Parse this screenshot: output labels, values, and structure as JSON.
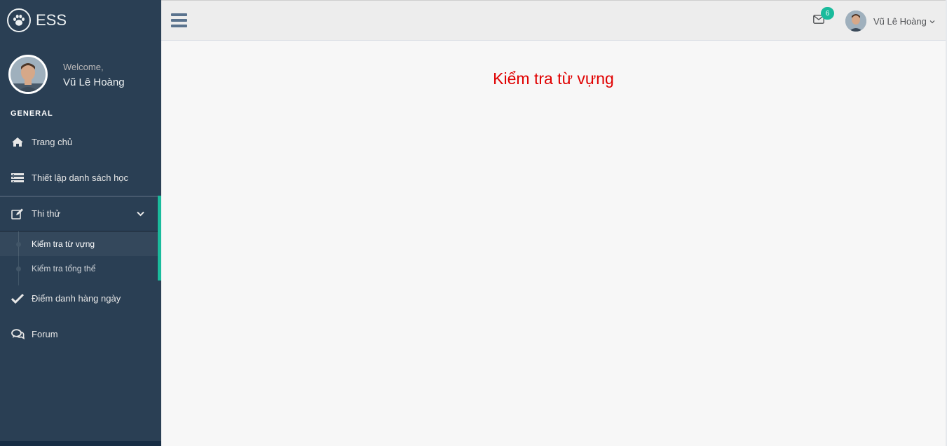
{
  "brand": {
    "name": "ESS",
    "logo_icon": "paw-icon"
  },
  "profile": {
    "welcome": "Welcome,",
    "name": "Vũ Lê Hoàng"
  },
  "sidebar": {
    "section": "GENERAL",
    "items": [
      {
        "label": "Trang chủ",
        "icon": "home-icon"
      },
      {
        "label": "Thiết lập danh sách học",
        "icon": "list-icon"
      },
      {
        "label": "Thi thử",
        "icon": "edit-icon",
        "expanded": true,
        "children": [
          {
            "label": "Kiểm tra từ vựng",
            "current": true
          },
          {
            "label": "Kiểm tra tổng thể",
            "current": false
          }
        ]
      },
      {
        "label": "Điểm danh hàng ngày",
        "icon": "check-icon"
      },
      {
        "label": "Forum",
        "icon": "comments-icon"
      }
    ]
  },
  "topnav": {
    "mail_badge": "6",
    "user_name": "Vũ Lê Hoàng"
  },
  "main": {
    "title": "Kiểm tra từ vựng"
  },
  "colors": {
    "sidebar": "#2A3F54",
    "accent": "#1ABB9C",
    "title": "#E00000"
  }
}
